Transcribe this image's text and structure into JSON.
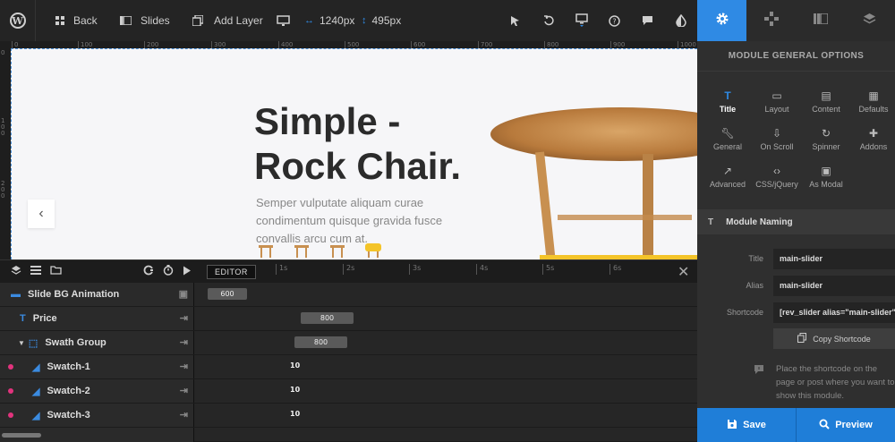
{
  "toolbar": {
    "back_label": "Back",
    "slides_label": "Slides",
    "add_layer_label": "Add Layer",
    "width_value": "1240px",
    "height_value": "495px"
  },
  "ruler": {
    "marks": [
      "0",
      "100",
      "200",
      "300",
      "400",
      "500",
      "600",
      "700",
      "800",
      "900",
      "1000"
    ]
  },
  "vruler": {
    "marks": [
      "0",
      "1",
      "0",
      "0",
      "2",
      "0",
      "0"
    ]
  },
  "slide": {
    "title_line1": "Simple -",
    "title_line2": "Rock Chair.",
    "description": "Semper vulputate aliquam curae condimentum quisque gravida fusce convallis arcu cum at."
  },
  "timeline": {
    "editor_label": "EDITOR",
    "seconds": [
      "1s",
      "2s",
      "3s",
      "4s",
      "5s",
      "6s"
    ],
    "rows": [
      {
        "label": "Slide BG Animation",
        "value": "600"
      },
      {
        "label": "Price",
        "value": "800"
      },
      {
        "label": "Swath Group",
        "value": "800"
      },
      {
        "label": "Swatch-1",
        "value": "10"
      },
      {
        "label": "Swatch-2",
        "value": "10"
      },
      {
        "label": "Swatch-3",
        "value": "10"
      }
    ]
  },
  "panel": {
    "title": "MODULE GENERAL OPTIONS",
    "options": [
      "Title",
      "Layout",
      "Content",
      "Defaults",
      "General",
      "On Scroll",
      "Spinner",
      "Addons",
      "Advanced",
      "CSS/jQuery",
      "As Modal"
    ],
    "section_title": "Module Naming",
    "title_label": "Title",
    "title_value": "main-slider",
    "alias_label": "Alias",
    "alias_value": "main-slider",
    "shortcode_label": "Shortcode",
    "shortcode_value": "[rev_slider alias=\"main-slider\"]",
    "copy_label": "Copy Shortcode",
    "hint": "Place the shortcode on the page or post where you want to show this module.",
    "save_label": "Save",
    "preview_label": "Preview"
  },
  "colors": {
    "accent": "#2f8ae4",
    "dot": "#e2337d",
    "panel_bg": "#2f2f2f"
  }
}
